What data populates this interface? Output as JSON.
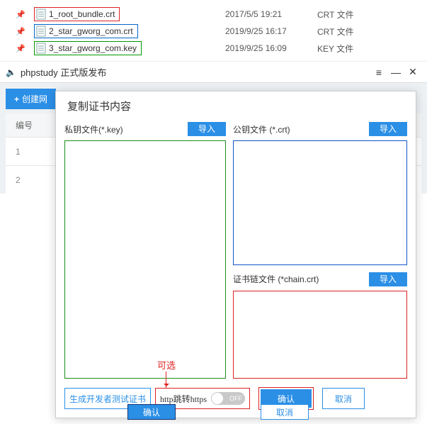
{
  "files": [
    {
      "name": "1_root_bundle.crt",
      "date": "2017/5/5 19:21",
      "type": "CRT 文件"
    },
    {
      "name": "2_star_gworg_com.crt",
      "date": "2019/9/25 16:17",
      "type": "CRT 文件"
    },
    {
      "name": "3_star_gworg_com.key",
      "date": "2019/9/25 16:09",
      "type": "KEY 文件"
    }
  ],
  "app": {
    "title": "phpstudy 正式版发布",
    "menu": "≡",
    "min": "—",
    "close": "✕"
  },
  "toolbar": {
    "create": "创建网",
    "plus": "+"
  },
  "table": {
    "col1": "编号",
    "row1": "1",
    "row2": "2"
  },
  "dialog": {
    "title": "复制证书内容",
    "keyLabel": "私钥文件(*.key)",
    "crtLabel": "公钥文件  (*.crt)",
    "chainLabel": "证书链文件 (*chain.crt)",
    "import": "导入",
    "genDev": "生成开发者测试证书",
    "httpJump": "http跳转https",
    "toggle": "OFF",
    "confirm": "确认",
    "cancel": "取消"
  },
  "bottom": {
    "confirm": "确认",
    "cancel": "取消"
  },
  "anno": {
    "optional": "可选"
  }
}
